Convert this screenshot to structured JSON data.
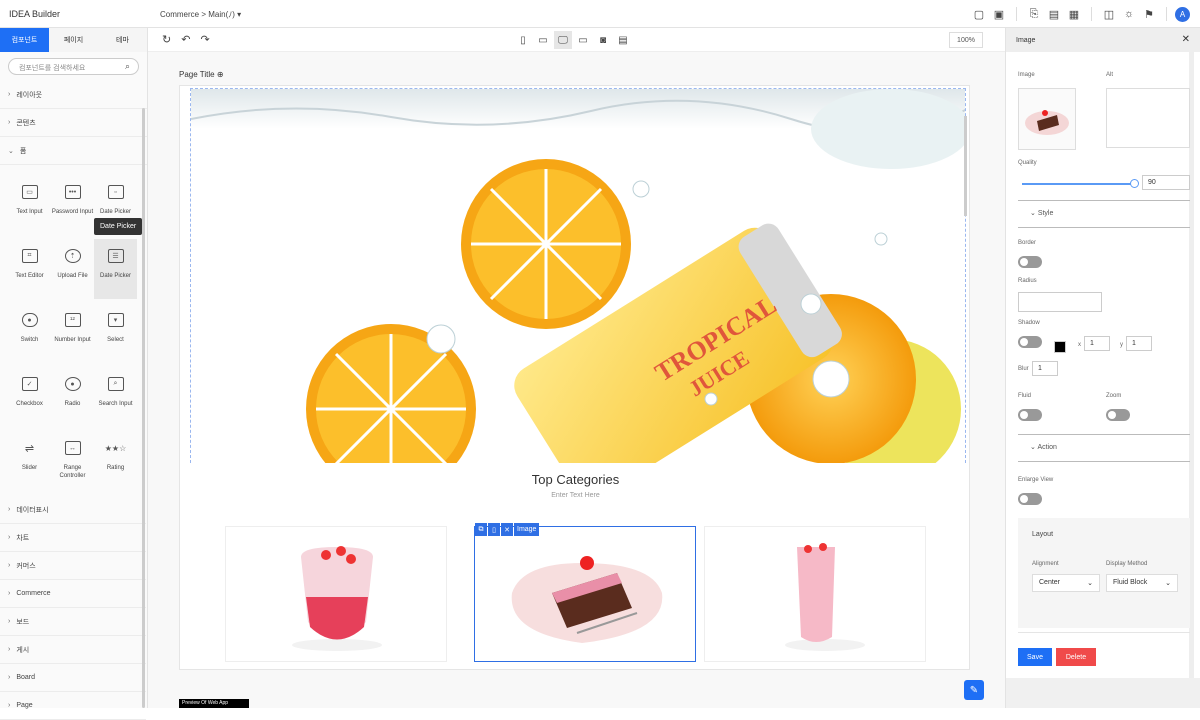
{
  "header": {
    "app_title": "IDEA Builder",
    "breadcrumb": "Commerce >  Main(ﾉ) ▾",
    "avatar_letter": "A"
  },
  "left_panel": {
    "tabs": [
      "컴포넌트",
      "페이지",
      "테마"
    ],
    "search_placeholder": "컴포넌트를 검색하세요",
    "sections_top": [
      "레이아웃",
      "콘텐츠",
      "폼"
    ],
    "components": [
      {
        "label": "Text Input",
        "icon": "text-input-icon"
      },
      {
        "label": "Password Input",
        "icon": "password-input-icon"
      },
      {
        "label": "Date Picker",
        "icon": "date-picker-icon"
      },
      {
        "label": "Text Editor",
        "icon": "text-editor-icon"
      },
      {
        "label": "Upload File",
        "icon": "upload-file-icon"
      },
      {
        "label": "Date Picker",
        "icon": "date-picker-icon"
      },
      {
        "label": "Switch",
        "icon": "switch-icon"
      },
      {
        "label": "Number Input",
        "icon": "number-input-icon"
      },
      {
        "label": "Select",
        "icon": "select-icon"
      },
      {
        "label": "Checkbox",
        "icon": "checkbox-icon"
      },
      {
        "label": "Radio",
        "icon": "radio-icon"
      },
      {
        "label": "Search Input",
        "icon": "search-input-icon"
      },
      {
        "label": "Slider",
        "icon": "slider-icon"
      },
      {
        "label": "Range Controller",
        "icon": "range-icon"
      },
      {
        "label": "Rating",
        "icon": "rating-icon"
      }
    ],
    "tooltip": "Date Picker",
    "sections_bottom": [
      "데이터표시",
      "차트",
      "커머스",
      "Commerce",
      "보드",
      "게시",
      "Board",
      "Page"
    ]
  },
  "canvas": {
    "zoom": "100%",
    "page_title": "Page Title",
    "section_title": "Top Categories",
    "section_subtitle": "Enter Text Here",
    "selection_label": "Image",
    "footer_badge": "Preview Of Web App"
  },
  "right_panel": {
    "title": "Image",
    "image_label": "Image",
    "alt_label": "Alt",
    "quality_label": "Quality",
    "quality_value": "90",
    "style_label": "Style",
    "border_label": "Border",
    "radius_label": "Radius",
    "shadow_label": "Shadow",
    "shadow_x": "1",
    "shadow_y": "1",
    "blur_label": "Blur",
    "blur_value": "1",
    "fluid_label": "Fluid",
    "zoom_label": "Zoom",
    "action_label": "Action",
    "enlarge_label": "Enlarge View",
    "layout_label": "Layout",
    "alignment_label": "Alignment",
    "alignment_value": "Center",
    "display_label": "Display Method",
    "display_value": "Fluid Block",
    "save_label": "Save",
    "delete_label": "Delete"
  },
  "colors": {
    "accent": "#1e6ff5",
    "delete": "#f04a4a"
  }
}
